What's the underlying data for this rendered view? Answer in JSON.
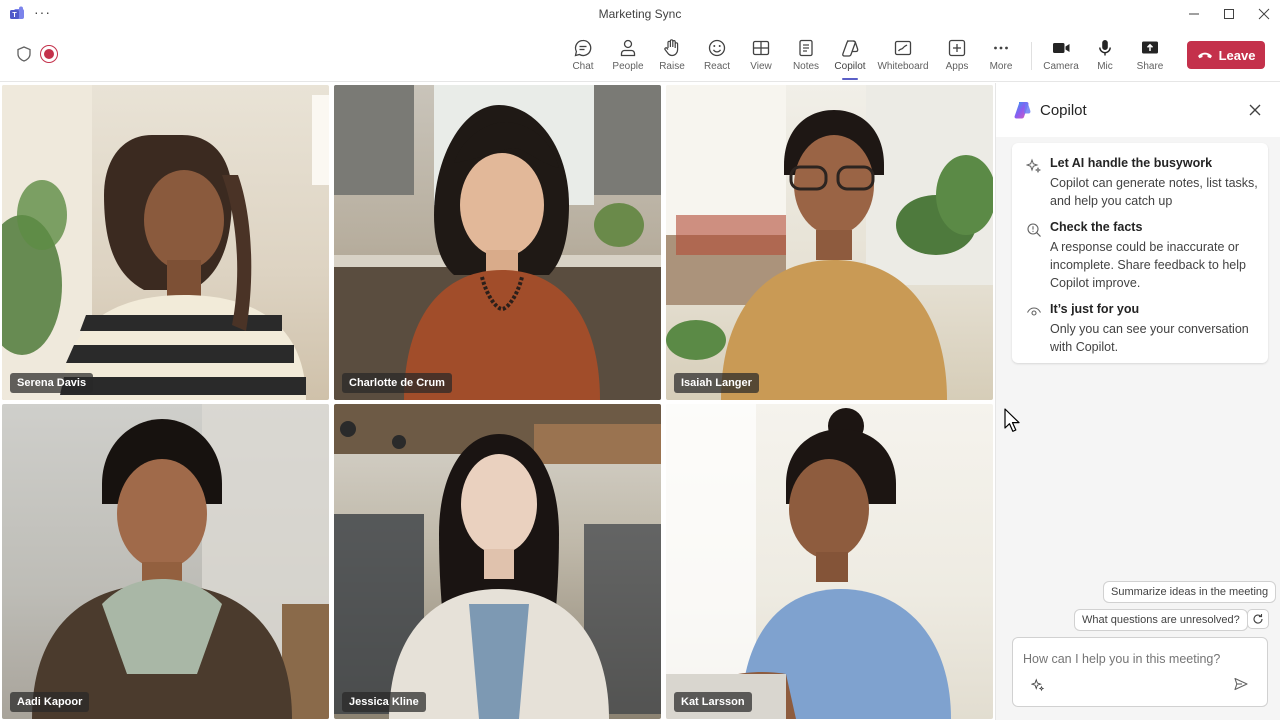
{
  "window": {
    "title": "Marketing Sync",
    "more_glyph": "···"
  },
  "toolbar": {
    "buttons": [
      {
        "label": "Chat",
        "icon": "chat-icon"
      },
      {
        "label": "People",
        "icon": "people-icon"
      },
      {
        "label": "Raise",
        "icon": "raise-hand-icon"
      },
      {
        "label": "React",
        "icon": "react-icon"
      },
      {
        "label": "View",
        "icon": "view-icon"
      },
      {
        "label": "Notes",
        "icon": "notes-icon"
      },
      {
        "label": "Copilot",
        "icon": "copilot-icon",
        "active": true
      },
      {
        "label": "Whiteboard",
        "icon": "whiteboard-icon"
      },
      {
        "label": "Apps",
        "icon": "apps-icon"
      },
      {
        "label": "More",
        "icon": "more-icon"
      },
      {
        "label": "Camera",
        "icon": "camera-icon"
      },
      {
        "label": "Mic",
        "icon": "mic-icon"
      },
      {
        "label": "Share",
        "icon": "share-icon"
      }
    ],
    "leave_label": "Leave",
    "leave_color": "#c4314b",
    "accent_color": "#5b5fc7"
  },
  "participants": [
    {
      "name": "Serena Davis"
    },
    {
      "name": "Charlotte de Crum"
    },
    {
      "name": "Isaiah Langer"
    },
    {
      "name": "Aadi Kapoor"
    },
    {
      "name": "Jessica Kline"
    },
    {
      "name": "Kat Larsson"
    }
  ],
  "copilot": {
    "title": "Copilot",
    "info": [
      {
        "icon": "sparkle-icon",
        "title": "Let AI handle the busywork",
        "body": "Copilot can generate notes, list tasks, and help you catch up"
      },
      {
        "icon": "search-check-icon",
        "title": "Check the facts",
        "body": "A response could be inaccurate or incomplete. Share feedback to help Copilot improve."
      },
      {
        "icon": "eye-icon",
        "title": "It’s just for you",
        "body": "Only you can see your conversation with Copilot."
      }
    ],
    "suggestions": [
      "Summarize ideas in the meeting",
      "What questions are unresolved?"
    ],
    "composer_placeholder": "How can I help you in this meeting?"
  }
}
